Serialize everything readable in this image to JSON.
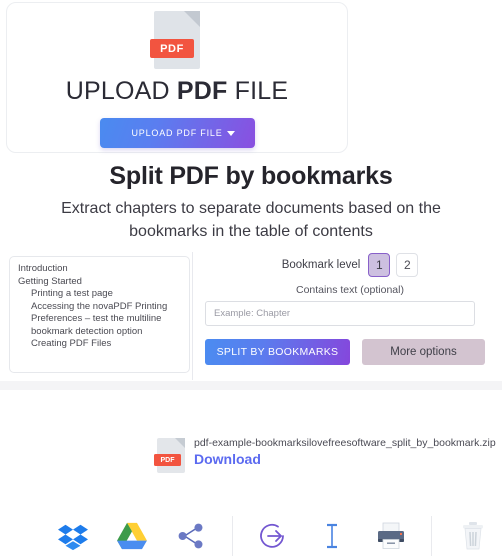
{
  "upload_card": {
    "file_icon_label": "PDF",
    "title_prefix": "UPLOAD ",
    "title_strong": "PDF",
    "title_suffix": " FILE",
    "button_label": "UPLOAD PDF FILE",
    "caret_icon": "chevron-down-icon"
  },
  "heading": {
    "title": "Split PDF by bookmarks",
    "subtitle": "Extract chapters to separate documents based on the bookmarks in the table of contents"
  },
  "bookmarks": [
    {
      "label": "Introduction",
      "level": 1
    },
    {
      "label": "Getting Started",
      "level": 1
    },
    {
      "label": "Printing a test page",
      "level": 2
    },
    {
      "label": "Accessing the novaPDF Printing Preferences – test the multiline bookmark detection option",
      "level": 2
    },
    {
      "label": "Creating PDF Files",
      "level": 2
    }
  ],
  "options": {
    "level_label": "Bookmark level",
    "levels": [
      "1",
      "2"
    ],
    "selected_level": "1",
    "contains_label": "Contains text (optional)",
    "contains_value": "",
    "contains_placeholder": "Example: Chapter",
    "split_button": "SPLIT BY BOOKMARKS",
    "more_button": "More options"
  },
  "result": {
    "file_icon_label": "PDF",
    "filename": "pdf-example-bookmarksilovefreesoftware_split_by_bookmark.zip",
    "download_label": "Download"
  },
  "actions": [
    {
      "name": "dropbox",
      "title": "Dropbox"
    },
    {
      "name": "google-drive",
      "title": "Google Drive"
    },
    {
      "name": "share",
      "title": "Share"
    },
    {
      "name": "continue-arrow",
      "title": "Continue"
    },
    {
      "name": "rename",
      "title": "Rename"
    },
    {
      "name": "print",
      "title": "Print"
    },
    {
      "name": "delete",
      "title": "Delete"
    }
  ],
  "colors": {
    "accent_blue": "#4b8cf1",
    "accent_purple": "#8547dc",
    "pdf_red": "#f25440",
    "download_blue": "#5b6af0",
    "more_options_bg": "#d3c4d0",
    "level_active_bg": "#cdc0e0",
    "level_active_border": "#8860c9"
  }
}
